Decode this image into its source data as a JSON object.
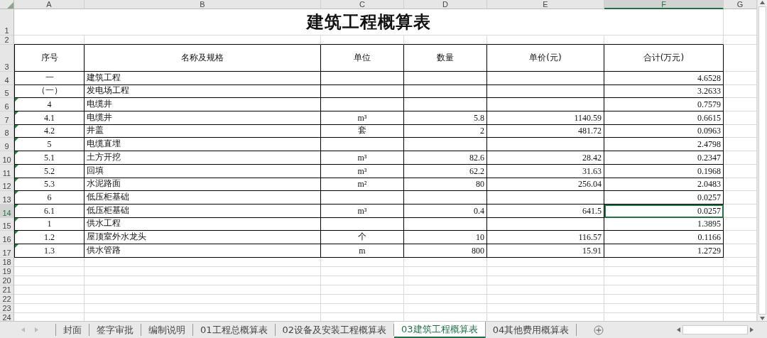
{
  "columns": [
    {
      "label": "A",
      "selected": false
    },
    {
      "label": "B",
      "selected": false
    },
    {
      "label": "C",
      "selected": false
    },
    {
      "label": "D",
      "selected": false
    },
    {
      "label": "E",
      "selected": false
    },
    {
      "label": "F",
      "selected": true
    },
    {
      "label": "G",
      "selected": false
    }
  ],
  "rows": [
    {
      "number": "1",
      "kind": "title",
      "selected": false,
      "title": "建筑工程概算表"
    },
    {
      "number": "2",
      "kind": "blank",
      "selected": false
    },
    {
      "number": "3",
      "kind": "header",
      "selected": false,
      "cells": [
        "序号",
        "名称及规格",
        "单位",
        "数量",
        "单价(元)",
        "合计(万元)"
      ]
    },
    {
      "number": "4",
      "kind": "data",
      "selected": false,
      "flag": false,
      "cells": [
        "一",
        "建筑工程",
        null,
        null,
        null,
        "4.6528"
      ]
    },
    {
      "number": "5",
      "kind": "data",
      "selected": false,
      "flag": false,
      "cells": [
        "（一）",
        "发电场工程",
        null,
        null,
        null,
        "3.2633"
      ]
    },
    {
      "number": "6",
      "kind": "data",
      "selected": false,
      "flag": true,
      "cells": [
        "4",
        "电缆井",
        null,
        null,
        null,
        "0.7579"
      ]
    },
    {
      "number": "7",
      "kind": "data",
      "selected": false,
      "flag": true,
      "cells": [
        "4.1",
        "电缆井",
        "m³",
        "5.8",
        "1140.59",
        "0.6615"
      ]
    },
    {
      "number": "8",
      "kind": "data",
      "selected": false,
      "flag": true,
      "cells": [
        "4.2",
        "井盖",
        "套",
        "2",
        "481.72",
        "0.0963"
      ]
    },
    {
      "number": "9",
      "kind": "data",
      "selected": false,
      "flag": true,
      "cells": [
        "5",
        "电缆直埋",
        null,
        null,
        null,
        "2.4798"
      ]
    },
    {
      "number": "10",
      "kind": "data",
      "selected": false,
      "flag": true,
      "cells": [
        "5.1",
        "土方开挖",
        "m³",
        "82.6",
        "28.42",
        "0.2347"
      ]
    },
    {
      "number": "11",
      "kind": "data",
      "selected": false,
      "flag": true,
      "cells": [
        "5.2",
        "回填",
        "m³",
        "62.2",
        "31.63",
        "0.1968"
      ]
    },
    {
      "number": "12",
      "kind": "data",
      "selected": false,
      "flag": true,
      "cells": [
        "5.3",
        "水泥路面",
        "m²",
        "80",
        "256.04",
        "2.0483"
      ]
    },
    {
      "number": "13",
      "kind": "data",
      "selected": false,
      "flag": true,
      "cells": [
        "6",
        "低压柜基础",
        null,
        null,
        null,
        "0.0257"
      ]
    },
    {
      "number": "14",
      "kind": "data",
      "selected": true,
      "flag": true,
      "cells": [
        "6.1",
        "低压柜基础",
        "m³",
        "0.4",
        "641.5",
        "0.0257"
      ]
    },
    {
      "number": "15",
      "kind": "data",
      "selected": false,
      "flag": true,
      "cells": [
        "1",
        "供水工程",
        null,
        null,
        null,
        "1.3895"
      ]
    },
    {
      "number": "16",
      "kind": "data",
      "selected": false,
      "flag": true,
      "cells": [
        "1.2",
        "屋顶室外水龙头",
        "个",
        "10",
        "116.57",
        "0.1166"
      ]
    },
    {
      "number": "17",
      "kind": "data",
      "selected": false,
      "flag": true,
      "cells": [
        "1.3",
        "供水管路",
        "m",
        "800",
        "15.91",
        "1.2729"
      ]
    },
    {
      "number": "18",
      "kind": "blank",
      "selected": false
    },
    {
      "number": "19",
      "kind": "blank",
      "selected": false
    },
    {
      "number": "20",
      "kind": "blank",
      "selected": false
    },
    {
      "number": "21",
      "kind": "blank",
      "selected": false
    },
    {
      "number": "22",
      "kind": "blank",
      "selected": false
    },
    {
      "number": "23",
      "kind": "blank",
      "selected": false
    },
    {
      "number": "24",
      "kind": "blank",
      "selected": false
    }
  ],
  "sheet_tabs": [
    {
      "label": "封面",
      "selected": false
    },
    {
      "label": "签字审批",
      "selected": false
    },
    {
      "label": "编制说明",
      "selected": false
    },
    {
      "label": "01工程总概算表",
      "selected": false
    },
    {
      "label": "02设备及安装工程概算表",
      "selected": false
    },
    {
      "label": "03建筑工程概算表",
      "selected": true
    },
    {
      "label": "04其他费用概算表",
      "selected": false
    }
  ]
}
